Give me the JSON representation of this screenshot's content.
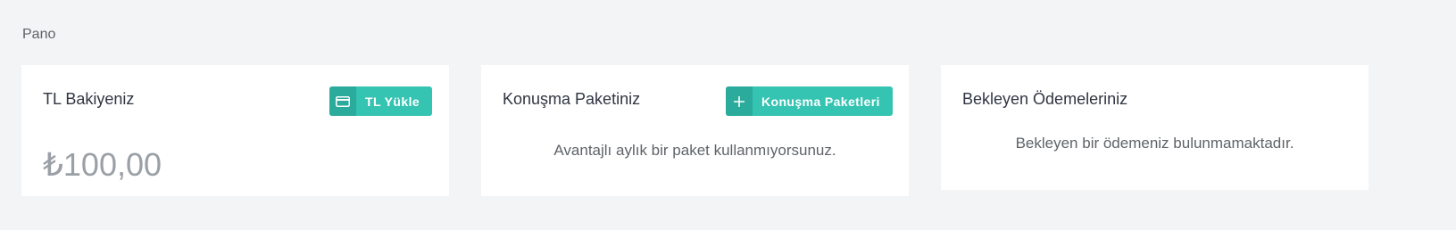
{
  "page": {
    "title": "Pano"
  },
  "cards": [
    {
      "title": "TL Bakiyeniz",
      "button_label": "TL Yükle",
      "button_icon": "credit-card-icon",
      "amount": "₺100,00"
    },
    {
      "title": "Konuşma Paketiniz",
      "button_label": "Konuşma Paketleri",
      "button_icon": "plus-icon",
      "message": "Avantajlı aylık bir paket kullanmıyorsunuz."
    },
    {
      "title": "Bekleyen Ödemeleriniz",
      "message": "Bekleyen bir ödemeniz bulunmamaktadır."
    }
  ],
  "colors": {
    "background": "#f3f4f6",
    "card": "#ffffff",
    "accent": "#35c3b2",
    "accent_dark": "#2aab9c",
    "muted": "#9aa0a6"
  }
}
